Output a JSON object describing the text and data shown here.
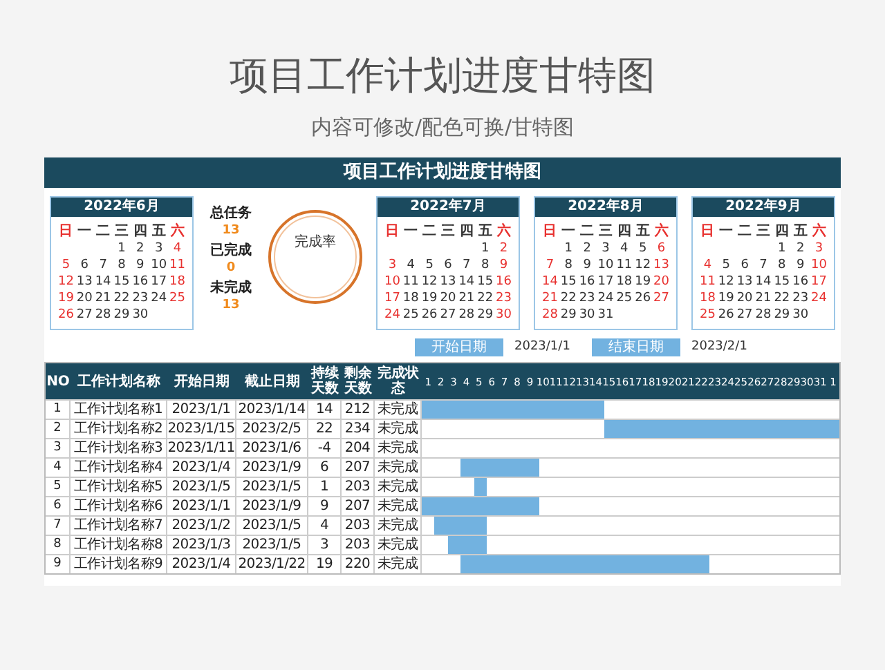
{
  "page_title": "项目工作计划进度甘特图",
  "subtitle": "内容可修改/配色可换/甘特图",
  "sheet": {
    "title": "项目工作计划进度甘特图"
  },
  "calendars": [
    {
      "title": "2022年6月",
      "weekdays": [
        "日",
        "一",
        "二",
        "三",
        "四",
        "五",
        "六"
      ],
      "weeks": [
        [
          "1",
          "2",
          "3",
          "4"
        ],
        [
          "5",
          "6",
          "7",
          "8",
          "9",
          "10",
          "11"
        ],
        [
          "12",
          "13",
          "14",
          "15",
          "16",
          "17",
          "18"
        ],
        [
          "19",
          "20",
          "21",
          "22",
          "23",
          "24",
          "25"
        ],
        [
          "26",
          "27",
          "28",
          "29",
          "30"
        ]
      ]
    },
    {
      "title": "2022年7月",
      "weekdays": [
        "日",
        "一",
        "二",
        "三",
        "四",
        "五",
        "六"
      ],
      "weeks": [
        [
          "1",
          "2"
        ],
        [
          "3",
          "4",
          "5",
          "6",
          "7",
          "8",
          "9"
        ],
        [
          "10",
          "11",
          "12",
          "13",
          "14",
          "15",
          "16"
        ],
        [
          "17",
          "18",
          "19",
          "20",
          "21",
          "22",
          "23"
        ],
        [
          "24",
          "25",
          "26",
          "27",
          "28",
          "29",
          "30"
        ]
      ]
    },
    {
      "title": "2022年8月",
      "weekdays": [
        "日",
        "一",
        "二",
        "三",
        "四",
        "五",
        "六"
      ],
      "weeks": [
        [
          "1",
          "2",
          "3",
          "4",
          "5",
          "6"
        ],
        [
          "7",
          "8",
          "9",
          "10",
          "11",
          "12",
          "13"
        ],
        [
          "14",
          "15",
          "16",
          "17",
          "18",
          "19",
          "20"
        ],
        [
          "21",
          "22",
          "23",
          "24",
          "25",
          "26",
          "27"
        ],
        [
          "28",
          "29",
          "30",
          "31"
        ]
      ]
    },
    {
      "title": "2022年9月",
      "weekdays": [
        "日",
        "一",
        "二",
        "三",
        "四",
        "五",
        "六"
      ],
      "weeks": [
        [
          "1",
          "2",
          "3"
        ],
        [
          "4",
          "5",
          "6",
          "7",
          "8",
          "9",
          "10"
        ],
        [
          "11",
          "12",
          "13",
          "14",
          "15",
          "16",
          "17"
        ],
        [
          "18",
          "19",
          "20",
          "21",
          "22",
          "23",
          "24"
        ],
        [
          "25",
          "26",
          "27",
          "28",
          "29",
          "30"
        ]
      ]
    }
  ],
  "summary": [
    {
      "label": "总任务",
      "value": "13"
    },
    {
      "label": "已完成",
      "value": "0"
    },
    {
      "label": "未完成",
      "value": "13"
    }
  ],
  "completion_ring": {
    "label": "完成率"
  },
  "date_range": [
    {
      "label": "开始日期",
      "value": "2023/1/1"
    },
    {
      "label": "结束日期",
      "value": "2023/2/1"
    }
  ],
  "table": {
    "columns": [
      "NO",
      "工作计划名称",
      "开始日期",
      "截止日期",
      "持续天数",
      "剩余天数",
      "完成状态"
    ],
    "days": [
      "1",
      "2",
      "3",
      "4",
      "5",
      "6",
      "7",
      "8",
      "9",
      "10",
      "11",
      "12",
      "13",
      "14",
      "15",
      "16",
      "17",
      "18",
      "19",
      "20",
      "21",
      "22",
      "23",
      "24",
      "25",
      "26",
      "27",
      "28",
      "29",
      "30",
      "31",
      "1"
    ],
    "rows": [
      {
        "cells": [
          "1",
          "工作计划名称1",
          "2023/1/1",
          "2023/1/14",
          "14",
          "212",
          "未完成"
        ],
        "timeline": [
          true,
          true,
          true,
          true,
          true,
          true,
          true,
          true,
          true,
          true,
          true,
          true,
          true,
          true,
          false,
          false,
          false,
          false,
          false,
          false,
          false,
          false,
          false,
          false,
          false,
          false,
          false,
          false,
          false,
          false,
          false,
          false
        ]
      },
      {
        "cells": [
          "2",
          "工作计划名称2",
          "2023/1/15",
          "2023/2/5",
          "22",
          "234",
          "未完成"
        ],
        "timeline": [
          false,
          false,
          false,
          false,
          false,
          false,
          false,
          false,
          false,
          false,
          false,
          false,
          false,
          false,
          true,
          true,
          true,
          true,
          true,
          true,
          true,
          true,
          true,
          true,
          true,
          true,
          true,
          true,
          true,
          true,
          true,
          true
        ]
      },
      {
        "cells": [
          "3",
          "工作计划名称3",
          "2023/1/11",
          "2023/1/6",
          "-4",
          "204",
          "未完成"
        ],
        "timeline": [
          false,
          false,
          false,
          false,
          false,
          false,
          false,
          false,
          false,
          false,
          false,
          false,
          false,
          false,
          false,
          false,
          false,
          false,
          false,
          false,
          false,
          false,
          false,
          false,
          false,
          false,
          false,
          false,
          false,
          false,
          false,
          false
        ]
      },
      {
        "cells": [
          "4",
          "工作计划名称4",
          "2023/1/4",
          "2023/1/9",
          "6",
          "207",
          "未完成"
        ],
        "timeline": [
          false,
          false,
          false,
          true,
          true,
          true,
          true,
          true,
          true,
          false,
          false,
          false,
          false,
          false,
          false,
          false,
          false,
          false,
          false,
          false,
          false,
          false,
          false,
          false,
          false,
          false,
          false,
          false,
          false,
          false,
          false,
          false
        ]
      },
      {
        "cells": [
          "5",
          "工作计划名称5",
          "2023/1/5",
          "2023/1/5",
          "1",
          "203",
          "未完成"
        ],
        "timeline": [
          false,
          false,
          false,
          false,
          true,
          false,
          false,
          false,
          false,
          false,
          false,
          false,
          false,
          false,
          false,
          false,
          false,
          false,
          false,
          false,
          false,
          false,
          false,
          false,
          false,
          false,
          false,
          false,
          false,
          false,
          false,
          false
        ]
      },
      {
        "cells": [
          "6",
          "工作计划名称6",
          "2023/1/1",
          "2023/1/9",
          "9",
          "207",
          "未完成"
        ],
        "timeline": [
          true,
          true,
          true,
          true,
          true,
          true,
          true,
          true,
          true,
          false,
          false,
          false,
          false,
          false,
          false,
          false,
          false,
          false,
          false,
          false,
          false,
          false,
          false,
          false,
          false,
          false,
          false,
          false,
          false,
          false,
          false,
          false
        ]
      },
      {
        "cells": [
          "7",
          "工作计划名称7",
          "2023/1/2",
          "2023/1/5",
          "4",
          "203",
          "未完成"
        ],
        "timeline": [
          false,
          true,
          true,
          true,
          true,
          false,
          false,
          false,
          false,
          false,
          false,
          false,
          false,
          false,
          false,
          false,
          false,
          false,
          false,
          false,
          false,
          false,
          false,
          false,
          false,
          false,
          false,
          false,
          false,
          false,
          false,
          false
        ]
      },
      {
        "cells": [
          "8",
          "工作计划名称8",
          "2023/1/3",
          "2023/1/5",
          "3",
          "203",
          "未完成"
        ],
        "timeline": [
          false,
          false,
          true,
          true,
          true,
          false,
          false,
          false,
          false,
          false,
          false,
          false,
          false,
          false,
          false,
          false,
          false,
          false,
          false,
          false,
          false,
          false,
          false,
          false,
          false,
          false,
          false,
          false,
          false,
          false,
          false,
          false
        ]
      },
      {
        "cells": [
          "9",
          "工作计划名称9",
          "2023/1/4",
          "2023/1/22",
          "19",
          "220",
          "未完成"
        ],
        "timeline": [
          false,
          false,
          false,
          true,
          true,
          true,
          true,
          true,
          true,
          true,
          true,
          true,
          true,
          true,
          true,
          true,
          true,
          true,
          true,
          true,
          true,
          true,
          false,
          false,
          false,
          false,
          false,
          false,
          false,
          false,
          false,
          false
        ]
      }
    ]
  }
}
